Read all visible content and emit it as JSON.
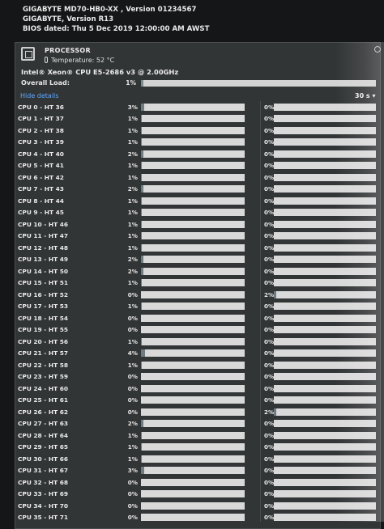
{
  "bios": {
    "line1": "GIGABYTE MD70-HB0-XX , Version 01234567",
    "line2": "GIGABYTE, Version R13",
    "line3": "BIOS dated: Thu 5 Dec 2019 12:00:00 AM AWST"
  },
  "processor": {
    "title": "PROCESSOR",
    "temperature": "Temperature: 52 °C",
    "model": "Intel® Xeon® CPU E5-2686 v3 @ 2.00GHz",
    "overall_label": "Overall Load:",
    "overall_value": "1%",
    "overall_fraction": 0.01,
    "hide_details": "Hide details",
    "timeframe": "30 s ▾"
  },
  "cpus": [
    {
      "name": "CPU 0 - HT 36",
      "v1": "3%",
      "v2": "0%"
    },
    {
      "name": "CPU 1 - HT 37",
      "v1": "1%",
      "v2": "0%"
    },
    {
      "name": "CPU 2 - HT 38",
      "v1": "1%",
      "v2": "0%"
    },
    {
      "name": "CPU 3 - HT 39",
      "v1": "1%",
      "v2": "0%"
    },
    {
      "name": "CPU 4 - HT 40",
      "v1": "2%",
      "v2": "0%"
    },
    {
      "name": "CPU 5 - HT 41",
      "v1": "1%",
      "v2": "0%"
    },
    {
      "name": "CPU 6 - HT 42",
      "v1": "1%",
      "v2": "0%"
    },
    {
      "name": "CPU 7 - HT 43",
      "v1": "2%",
      "v2": "0%"
    },
    {
      "name": "CPU 8 - HT 44",
      "v1": "1%",
      "v2": "0%"
    },
    {
      "name": "CPU 9 - HT 45",
      "v1": "1%",
      "v2": "0%"
    },
    {
      "name": "CPU 10 - HT 46",
      "v1": "1%",
      "v2": "0%"
    },
    {
      "name": "CPU 11 - HT 47",
      "v1": "1%",
      "v2": "0%"
    },
    {
      "name": "CPU 12 - HT 48",
      "v1": "1%",
      "v2": "0%"
    },
    {
      "name": "CPU 13 - HT 49",
      "v1": "2%",
      "v2": "0%"
    },
    {
      "name": "CPU 14 - HT 50",
      "v1": "2%",
      "v2": "0%"
    },
    {
      "name": "CPU 15 - HT 51",
      "v1": "1%",
      "v2": "0%"
    },
    {
      "name": "CPU 16 - HT 52",
      "v1": "0%",
      "v2": "2%"
    },
    {
      "name": "CPU 17 - HT 53",
      "v1": "1%",
      "v2": "0%"
    },
    {
      "name": "CPU 18 - HT 54",
      "v1": "0%",
      "v2": "0%"
    },
    {
      "name": "CPU 19 - HT 55",
      "v1": "0%",
      "v2": "0%"
    },
    {
      "name": "CPU 20 - HT 56",
      "v1": "1%",
      "v2": "0%"
    },
    {
      "name": "CPU 21 - HT 57",
      "v1": "4%",
      "v2": "0%"
    },
    {
      "name": "CPU 22 - HT 58",
      "v1": "1%",
      "v2": "0%"
    },
    {
      "name": "CPU 23 - HT 59",
      "v1": "0%",
      "v2": "0%"
    },
    {
      "name": "CPU 24 - HT 60",
      "v1": "0%",
      "v2": "0%"
    },
    {
      "name": "CPU 25 - HT 61",
      "v1": "0%",
      "v2": "0%"
    },
    {
      "name": "CPU 26 - HT 62",
      "v1": "0%",
      "v2": "2%"
    },
    {
      "name": "CPU 27 - HT 63",
      "v1": "2%",
      "v2": "0%"
    },
    {
      "name": "CPU 28 - HT 64",
      "v1": "1%",
      "v2": "0%"
    },
    {
      "name": "CPU 29 - HT 65",
      "v1": "1%",
      "v2": "0%"
    },
    {
      "name": "CPU 30 - HT 66",
      "v1": "1%",
      "v2": "0%"
    },
    {
      "name": "CPU 31 - HT 67",
      "v1": "3%",
      "v2": "0%"
    },
    {
      "name": "CPU 32 - HT 68",
      "v1": "0%",
      "v2": "0%"
    },
    {
      "name": "CPU 33 - HT 69",
      "v1": "0%",
      "v2": "0%"
    },
    {
      "name": "CPU 34 - HT 70",
      "v1": "0%",
      "v2": "0%"
    },
    {
      "name": "CPU 35 - HT 71",
      "v1": "0%",
      "v2": "0%"
    }
  ]
}
